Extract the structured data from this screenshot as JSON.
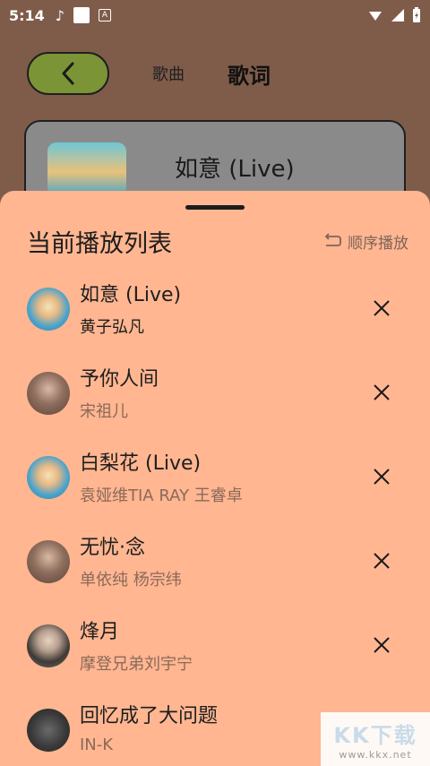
{
  "status_bar": {
    "time": "5:14",
    "badge": "A"
  },
  "nav": {
    "back_icon": "chevron-left-icon",
    "tab_song": "歌曲",
    "tab_lyrics": "歌词"
  },
  "background_card": {
    "title": "如意 (Live)"
  },
  "playlist": {
    "title": "当前播放列表",
    "mode_label": "顺序播放",
    "mode_icon": "repeat-icon",
    "items": [
      {
        "title": "如意 (Live)",
        "artist": "黄子弘凡",
        "active": true
      },
      {
        "title": "予你人间",
        "artist": "宋祖儿",
        "active": false
      },
      {
        "title": "白梨花 (Live)",
        "artist": "袁娅维TIA RAY 王睿卓",
        "active": false
      },
      {
        "title": "无忧·念",
        "artist": "单依纯 杨宗纬",
        "active": false
      },
      {
        "title": "烽月",
        "artist": "摩登兄弟刘宇宁",
        "active": false
      },
      {
        "title": "回忆成了大问题",
        "artist": "IN-K",
        "active": false
      }
    ]
  },
  "watermark": {
    "logo": "KK下载",
    "url": "www.kkx.net"
  },
  "colors": {
    "sheet": "#ffb691",
    "accent_button": "#7b9436",
    "muted_text": "#8b6a59"
  }
}
